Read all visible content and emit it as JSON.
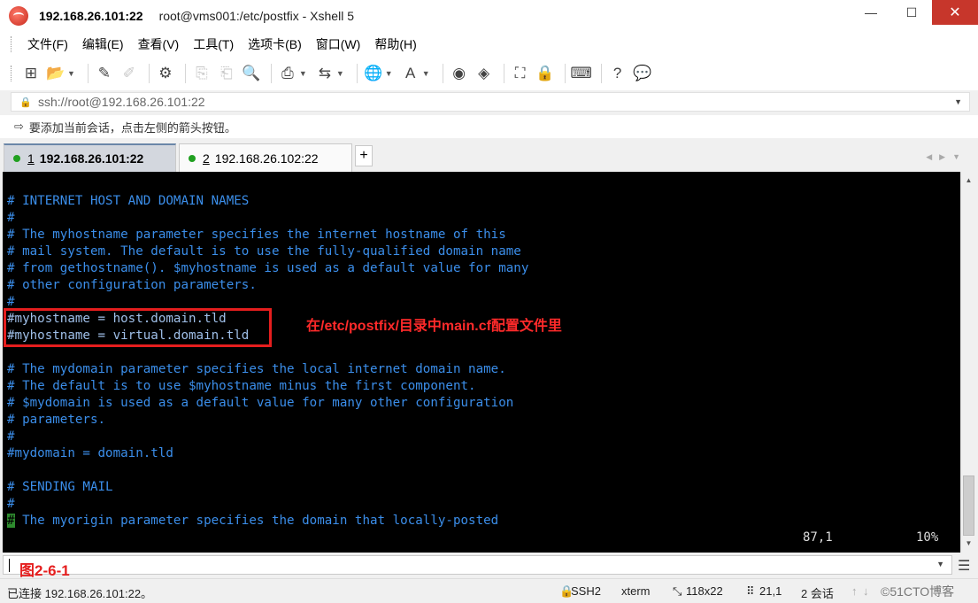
{
  "window": {
    "host_title": "192.168.26.101:22",
    "title_rest": "root@vms001:/etc/postfix - Xshell 5",
    "minimize": "—",
    "maximize": "☐",
    "close": "✕"
  },
  "menu": [
    "文件(F)",
    "编辑(E)",
    "查看(V)",
    "工具(T)",
    "选项卡(B)",
    "窗口(W)",
    "帮助(H)"
  ],
  "address": {
    "text": "ssh://root@192.168.26.101:22"
  },
  "hint": {
    "text": "要添加当前会话，点击左侧的箭头按钮。"
  },
  "tabs": [
    {
      "num": "1",
      "label": "192.168.26.101:22",
      "active": true,
      "status_color": "#20a020"
    },
    {
      "num": "2",
      "label": "192.168.26.102:22",
      "active": false,
      "status_color": "#20a020"
    }
  ],
  "tab_add": "+",
  "terminal": {
    "lines": [
      "# INTERNET HOST AND DOMAIN NAMES",
      "#",
      "# The myhostname parameter specifies the internet hostname of this",
      "# mail system. The default is to use the fully-qualified domain name",
      "# from gethostname(). $myhostname is used as a default value for many",
      "# other configuration parameters.",
      "#",
      "#myhostname = host.domain.tld",
      "#myhostname = virtual.domain.tld",
      "",
      "# The mydomain parameter specifies the local internet domain name.",
      "# The default is to use $myhostname minus the first component.",
      "# $mydomain is used as a default value for many other configuration",
      "# parameters.",
      "#",
      "#mydomain = domain.tld",
      "",
      "# SENDING MAIL",
      "#",
      "# The myorigin parameter specifies the domain that locally-posted"
    ],
    "cursor_char": "#",
    "last_line_rest": " The myorigin parameter specifies the domain that locally-posted",
    "position": "87,1",
    "percent": "10%",
    "annotation": "在/etc/postfix/目录中main.cf配置文件里",
    "fg_color": "#3b8eea",
    "bg_color": "#000000"
  },
  "compose": {
    "label": "图2-6-1"
  },
  "statusbar": {
    "connection": "已连接 192.168.26.101:22。",
    "protocol": "SSH2",
    "term": "xterm",
    "size": "118x22",
    "cursor": "21,1",
    "sessions": "2 会话",
    "watermark": "©51CTO博客"
  }
}
